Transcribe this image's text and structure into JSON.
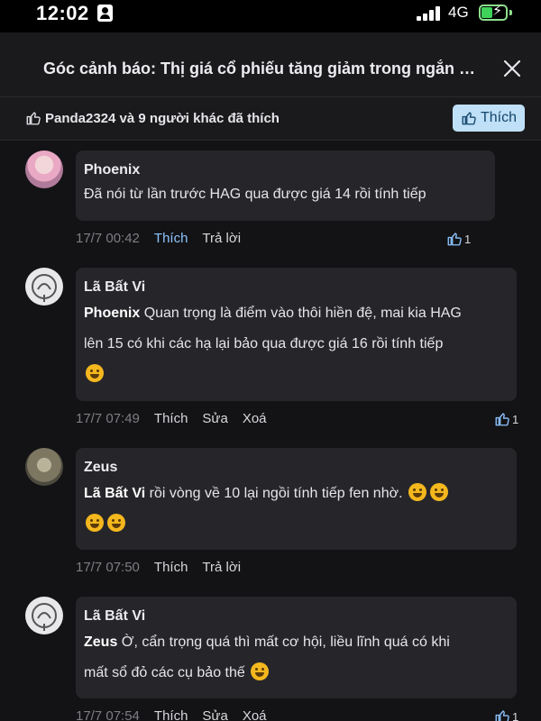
{
  "status_bar": {
    "time": "12:02",
    "network": "4G"
  },
  "header": {
    "title": "Góc cảnh báo: Thị giá cổ phiếu tăng giảm trong ngắn hạn"
  },
  "likes_bar": {
    "summary": "Panda2324 và 9 người khác đã thích",
    "like_button": "Thích"
  },
  "comments": [
    {
      "author": "Phoenix",
      "mention": "",
      "text": "Đã nói từ lần trước HAG qua được giá 14 rồi tính tiếp",
      "line2": "",
      "time": "17/7 00:42",
      "action1": "Thích",
      "action2": "Trả lời",
      "likes": "1"
    },
    {
      "author": "Lã Bất Vi",
      "mention": "Phoenix",
      "text": "Quan trọng là điểm vào thôi hiền đệ, mai kia HAG",
      "line2": "lên 15 có khi các hạ lại bảo qua được giá 16 rồi tính tiếp",
      "time": "17/7 07:49",
      "action1": "Thích",
      "action2": "Sửa",
      "action3": "Xoá",
      "likes": "1"
    },
    {
      "author": "Zeus",
      "mention": "Lã Bất Vi",
      "text": "rồi vòng về 10 lại ngồi tính tiếp fen nhờ.",
      "line2": "",
      "time": "17/7 07:50",
      "action1": "Thích",
      "action2": "Trả lời",
      "likes": ""
    },
    {
      "author": "Lã Bất Vi",
      "mention": "Zeus",
      "text": "Ờ, cẩn trọng quá thì mất cơ hội, liều lĩnh quá có khi",
      "line2": "mất sổ đỏ các cụ bảo thế",
      "time": "17/7 07:54",
      "action1": "Thích",
      "action2": "Sửa",
      "action3": "Xoá",
      "likes": "1"
    }
  ],
  "colors": {
    "background": "#131315",
    "bubble": "#26262a",
    "like_button": "#bfe0f7",
    "link_blue": "#8ec5ff"
  },
  "icons": [
    "person-icon",
    "signal-icon",
    "battery-charging-icon",
    "close-icon",
    "thumbs-up-icon",
    "emoji-icon"
  ]
}
